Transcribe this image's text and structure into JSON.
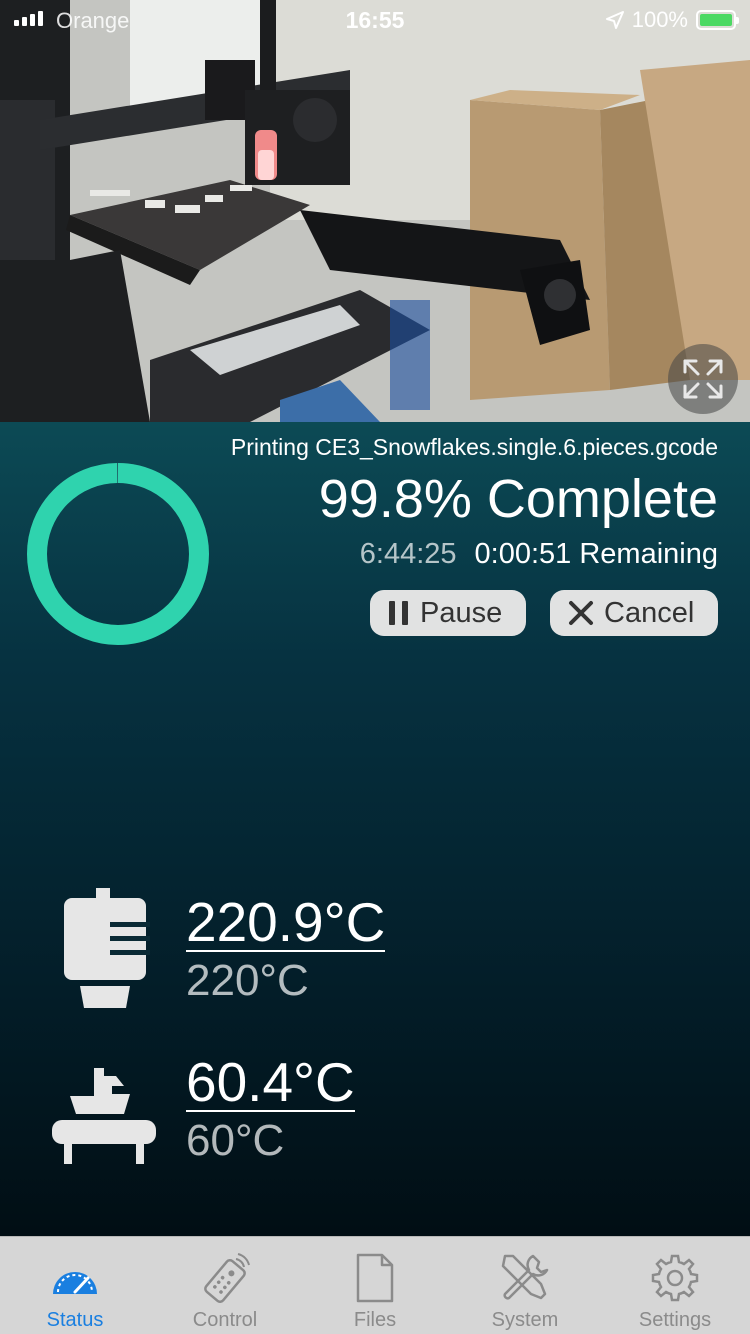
{
  "status_bar": {
    "carrier": "Orange",
    "time": "16:55",
    "battery": "100%"
  },
  "camera": {
    "expand_icon": "expand-arrows-icon"
  },
  "job": {
    "filename": "Printing CE3_Snowflakes.single.6.pieces.gcode",
    "progress_label": "99.8% Complete",
    "progress_fraction": 0.998,
    "elapsed": "6:44:25",
    "remaining": "0:00:51 Remaining"
  },
  "buttons": {
    "pause": "Pause",
    "cancel": "Cancel"
  },
  "temperatures": {
    "hotend": {
      "actual": "220.9°C",
      "target": "220°C",
      "icon": "hotend-icon"
    },
    "bed": {
      "actual": "60.4°C",
      "target": "60°C",
      "icon": "heated-bed-icon"
    }
  },
  "colors": {
    "accent_ring": "#2fd3ae",
    "tab_active": "#1a7fe0",
    "tab_inactive": "#8b8b8b"
  },
  "tabs": [
    {
      "label": "Status",
      "icon": "speedometer-icon",
      "active": true
    },
    {
      "label": "Control",
      "icon": "remote-control-icon",
      "active": false
    },
    {
      "label": "Files",
      "icon": "file-icon",
      "active": false
    },
    {
      "label": "System",
      "icon": "tools-icon",
      "active": false
    },
    {
      "label": "Settings",
      "icon": "gear-icon",
      "active": false
    }
  ]
}
